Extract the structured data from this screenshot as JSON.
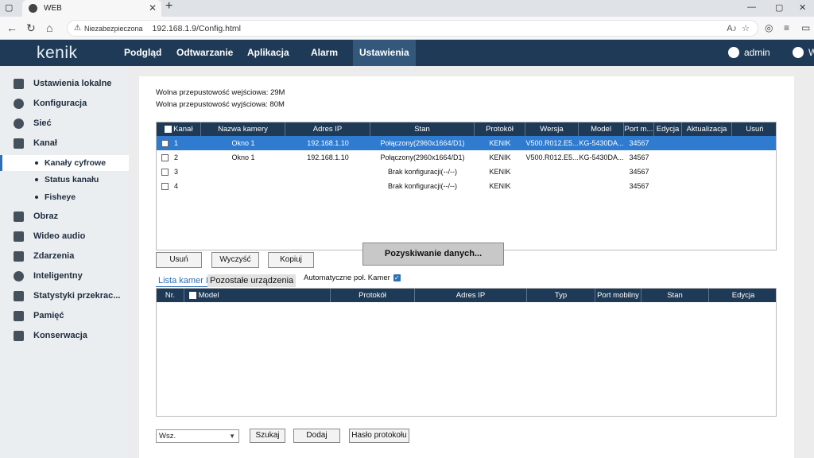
{
  "browser": {
    "tab_title": "WEB",
    "insecure_label": "Niezabezpieczona",
    "url": "192.168.1.9/Config.html"
  },
  "app": {
    "logo": "kenik",
    "menu": [
      "Podgląd",
      "Odtwarzanie",
      "Aplikacja",
      "Alarm",
      "Ustawienia"
    ],
    "active_menu": "Ustawienia",
    "user": "admin",
    "logout_label": "W"
  },
  "sidebar": {
    "items": [
      {
        "label": "Ustawienia lokalne",
        "icon": "monitor-icon"
      },
      {
        "label": "Konfiguracja",
        "icon": "info-icon"
      },
      {
        "label": "Sieć",
        "icon": "globe-icon"
      },
      {
        "label": "Kanał",
        "icon": "network-icon"
      }
    ],
    "subitems": [
      "Kanały cyfrowe",
      "Status kanału",
      "Fisheye"
    ],
    "items2": [
      {
        "label": "Obraz",
        "icon": "image-icon"
      },
      {
        "label": "Wideo audio",
        "icon": "video-icon"
      },
      {
        "label": "Zdarzenia",
        "icon": "bell-icon"
      },
      {
        "label": "Inteligentny",
        "icon": "brain-icon"
      },
      {
        "label": "Statystyki przekrac...",
        "icon": "chart-icon"
      },
      {
        "label": "Pamięć",
        "icon": "storage-icon"
      },
      {
        "label": "Konserwacja",
        "icon": "tools-icon"
      }
    ]
  },
  "main": {
    "bandwidth_in": "Wolna przepustowość wejściowa: 29M",
    "bandwidth_out": "Wolna przepustowość wyjściowa: 80M",
    "table1": {
      "headers": [
        "Kanał",
        "Nazwa kamery",
        "Adres IP",
        "Stan",
        "Protokół",
        "Wersja",
        "Model",
        "Port m...",
        "Edycja",
        "Aktualizacja",
        "Usuń"
      ],
      "rows": [
        {
          "ch": "1",
          "name": "Okno 1",
          "ip": "192.168.1.10",
          "state": "Połączony(2960x1664/D1)",
          "proto": "KENIK",
          "ver": "V500.R012.E5...",
          "model": "KG-5430DA...",
          "port": "34567"
        },
        {
          "ch": "2",
          "name": "Okno 1",
          "ip": "192.168.1.10",
          "state": "Połączony(2960x1664/D1)",
          "proto": "KENIK",
          "ver": "V500.R012.E5...",
          "model": "KG-5430DA...",
          "port": "34567"
        },
        {
          "ch": "3",
          "name": "",
          "ip": "",
          "state": "Brak konfiguracji(--/--)",
          "proto": "KENIK",
          "ver": "",
          "model": "",
          "port": "34567"
        },
        {
          "ch": "4",
          "name": "",
          "ip": "",
          "state": "Brak konfiguracji(--/--)",
          "proto": "KENIK",
          "ver": "",
          "model": "",
          "port": "34567"
        }
      ]
    },
    "buttons": {
      "delete": "Usuń",
      "clear": "Wyczyść",
      "copy": "Kopiuj",
      "fetch": "Pozyskiwanie danych..."
    },
    "tabs": [
      "Lista kamer IP",
      "Pozostałe urządzenia"
    ],
    "auto_label": "Automatyczne poł. Kamer",
    "table2": {
      "headers": [
        "Nr.",
        "Model",
        "Protokół",
        "Adres IP",
        "Typ",
        "Port mobilny",
        "Stan",
        "Edycja"
      ]
    },
    "bottom": {
      "select_value": "Wsz.",
      "search": "Szukaj",
      "add": "Dodaj",
      "proto_pass": "Hasło protokołu"
    }
  }
}
